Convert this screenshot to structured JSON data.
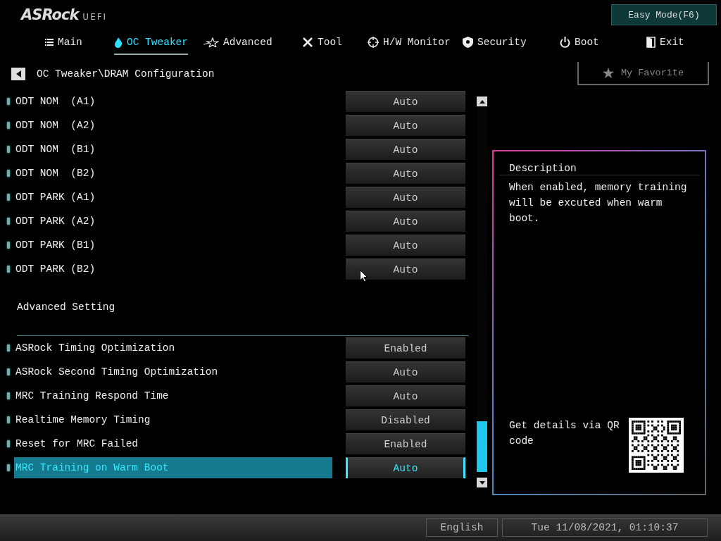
{
  "logo": {
    "brand": "ASRock",
    "suffix": "UEFI"
  },
  "easy_mode_button": "Easy Mode(F6)",
  "tabs": [
    {
      "label": "Main",
      "selected": false
    },
    {
      "label": "OC Tweaker",
      "selected": true
    },
    {
      "label": "Advanced",
      "selected": false
    },
    {
      "label": "Tool",
      "selected": false
    },
    {
      "label": "H/W Monitor",
      "selected": false
    },
    {
      "label": "Security",
      "selected": false
    },
    {
      "label": "Boot",
      "selected": false
    },
    {
      "label": "Exit",
      "selected": false
    }
  ],
  "breadcrumb": "OC Tweaker\\DRAM Configuration",
  "favorite_button": "My Favorite",
  "settings": [
    {
      "kind": "option",
      "label": "ODT NOM  (A1)",
      "value": "Auto",
      "selected": false
    },
    {
      "kind": "option",
      "label": "ODT NOM  (A2)",
      "value": "Auto",
      "selected": false
    },
    {
      "kind": "option",
      "label": "ODT NOM  (B1)",
      "value": "Auto",
      "selected": false
    },
    {
      "kind": "option",
      "label": "ODT NOM  (B2)",
      "value": "Auto",
      "selected": false
    },
    {
      "kind": "option",
      "label": "ODT PARK (A1)",
      "value": "Auto",
      "selected": false
    },
    {
      "kind": "option",
      "label": "ODT PARK (A2)",
      "value": "Auto",
      "selected": false
    },
    {
      "kind": "option",
      "label": "ODT PARK (B1)",
      "value": "Auto",
      "selected": false
    },
    {
      "kind": "option",
      "label": "ODT PARK (B2)",
      "value": "Auto",
      "selected": false
    },
    {
      "kind": "section",
      "label": "Advanced Setting"
    },
    {
      "kind": "option",
      "label": "ASRock Timing Optimization",
      "value": "Enabled",
      "selected": false
    },
    {
      "kind": "option",
      "label": "ASRock Second Timing Optimization",
      "value": "Auto",
      "selected": false
    },
    {
      "kind": "option",
      "label": "MRC Training Respond Time",
      "value": "Auto",
      "selected": false
    },
    {
      "kind": "option",
      "label": "Realtime Memory Timing",
      "value": "Disabled",
      "selected": false
    },
    {
      "kind": "option",
      "label": "Reset for MRC Failed",
      "value": "Enabled",
      "selected": false
    },
    {
      "kind": "option",
      "label": "MRC Training on Warm Boot",
      "value": "Auto",
      "selected": true
    }
  ],
  "description": {
    "title": "Description",
    "text": "When enabled, memory training will be excuted when warm boot.",
    "qr_text": "Get details via QR code"
  },
  "footer": {
    "language": "English",
    "datetime": "Tue 11/08/2021, 01:10:37"
  }
}
